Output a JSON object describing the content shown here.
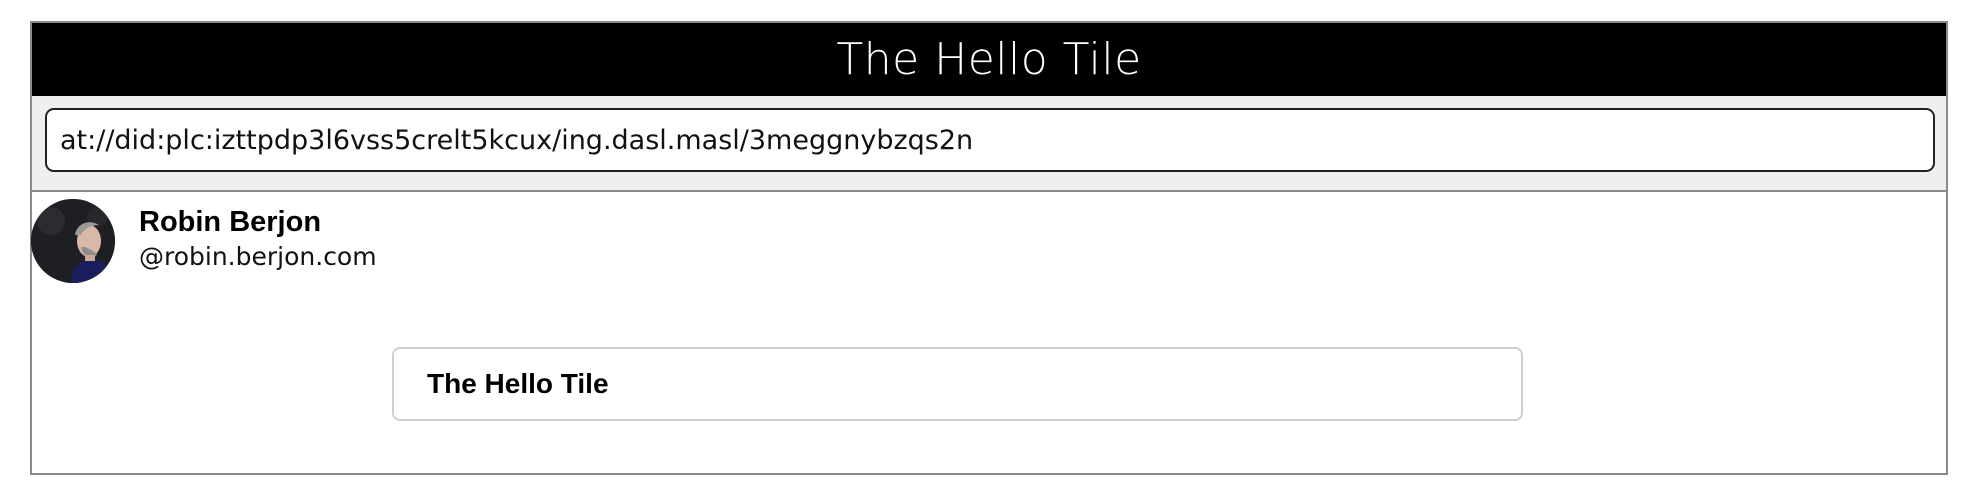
{
  "header": {
    "title": "The Hello Tile"
  },
  "urlbar": {
    "value": "at://did:plc:izttpdp3l6vss5crelt5kcux/ing.dasl.masl/3meggnybzqs2n"
  },
  "profile": {
    "display_name": "Robin Berjon",
    "handle": "@robin.berjon.com",
    "avatar_icon": "person-avatar-photo"
  },
  "tile": {
    "title": "The Hello Tile"
  },
  "colors": {
    "header_bg": "#000000",
    "header_text": "#ffffff",
    "urlbar_bg": "#efefef",
    "frame_border": "#8a8a8a",
    "tile_border": "#cfcfcf"
  }
}
